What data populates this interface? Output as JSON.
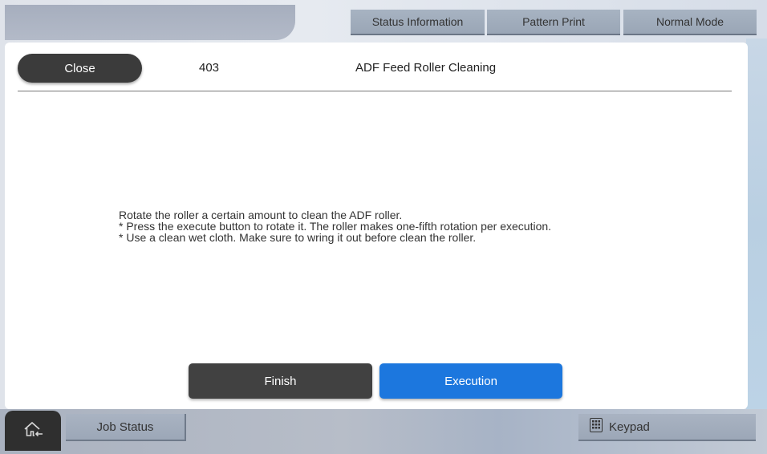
{
  "header": {
    "status_label": "Status Information",
    "pattern_label": "Pattern Print",
    "mode_label": "Normal Mode"
  },
  "dialog": {
    "close_label": "Close",
    "code": "403",
    "title": "ADF Feed Roller Cleaning",
    "message_lines": [
      "Rotate the roller a certain amount to clean the ADF roller.",
      "* Press the execute button to rotate it. The roller makes one-fifth rotation per execution.",
      "* Use a clean wet cloth. Make sure to wring it out before clean the roller."
    ],
    "finish_label": "Finish",
    "execution_label": "Execution"
  },
  "footer": {
    "home_icon": "home-icon",
    "job_status_label": "Job Status",
    "keypad_label": "Keypad",
    "keypad_icon": "keypad-icon"
  },
  "colors": {
    "execution_button": "#1c77de",
    "dark_button": "#3b3b3b"
  }
}
